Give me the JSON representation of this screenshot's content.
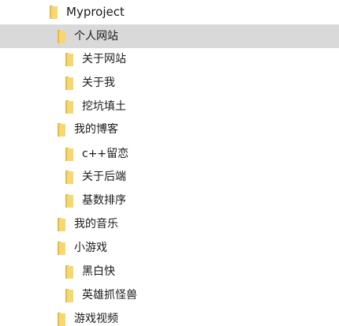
{
  "tree": {
    "root": {
      "label": "Myproject"
    },
    "items": [
      {
        "label": "个人网站",
        "selected": true
      },
      {
        "label": "关于网站"
      },
      {
        "label": "关于我"
      },
      {
        "label": "挖坑填土"
      },
      {
        "label": "我的博客"
      },
      {
        "label": "c++留恋"
      },
      {
        "label": "关于后端"
      },
      {
        "label": "基数排序"
      },
      {
        "label": "我的音乐"
      },
      {
        "label": "小游戏"
      },
      {
        "label": "黑白快"
      },
      {
        "label": "英雄抓怪兽"
      },
      {
        "label": "游戏视频"
      }
    ]
  },
  "colors": {
    "selection": "#d9d9d9",
    "folder_front": "#f7d774",
    "folder_back": "#e8b93a"
  },
  "icons": {
    "folder": "folder-icon"
  }
}
